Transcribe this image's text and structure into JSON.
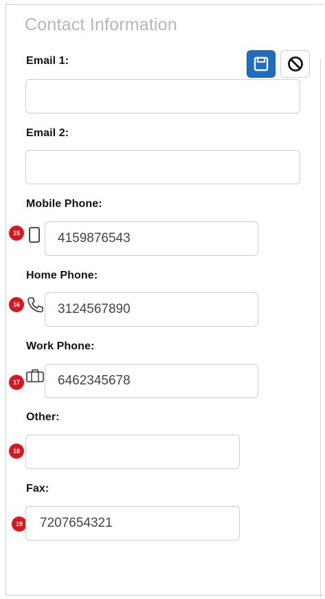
{
  "section_title": "Contact Information",
  "toolbar": {
    "save_icon": "save-icon",
    "cancel_icon": "cancel-icon",
    "accent": "#1b6ec2"
  },
  "fields": {
    "email1": {
      "label": "Email 1:",
      "value": ""
    },
    "email2": {
      "label": "Email 2:",
      "value": ""
    },
    "mobile": {
      "label": "Mobile Phone:",
      "value": "4159876543",
      "badge": "15",
      "icon": "mobile-phone-icon"
    },
    "home": {
      "label": "Home Phone:",
      "value": "3124567890",
      "badge": "16",
      "icon": "phone-handset-icon"
    },
    "work": {
      "label": "Work Phone:",
      "value": "6462345678",
      "badge": "17",
      "icon": "briefcase-icon"
    },
    "other": {
      "label": "Other:",
      "value": "",
      "badge": "18"
    },
    "fax": {
      "label": "Fax:",
      "value": "7207654321",
      "badge": "19"
    }
  },
  "badge_color": "#e0151b"
}
